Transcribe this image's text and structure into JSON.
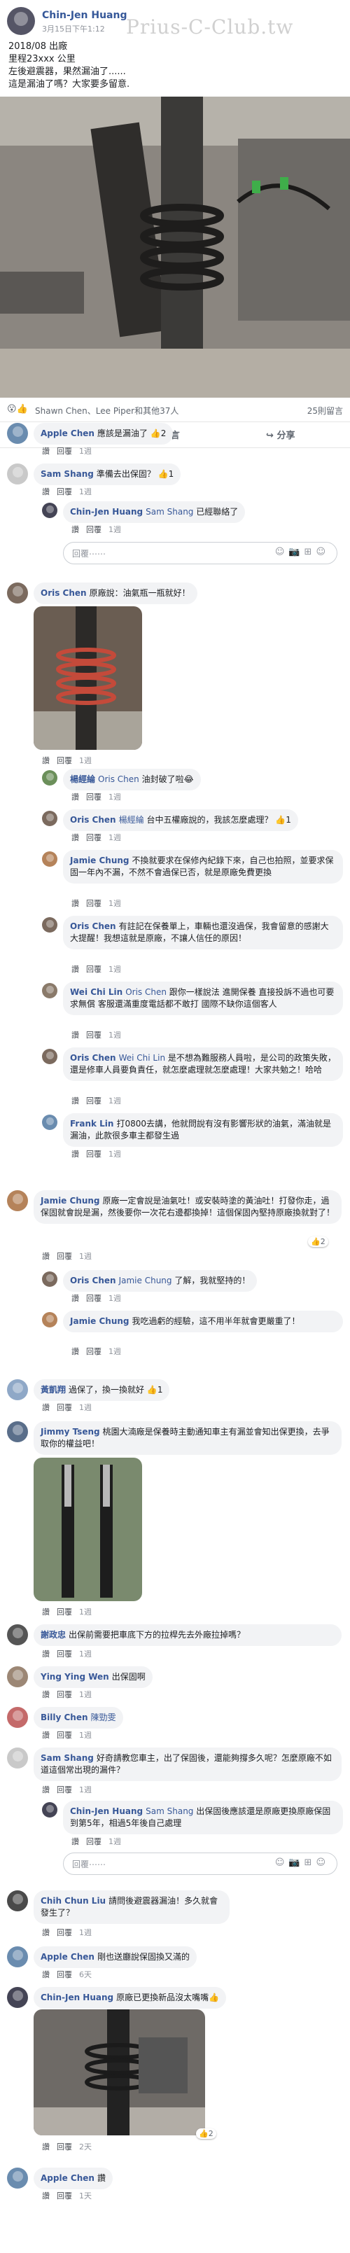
{
  "post": {
    "author": "Chin-Jen Huang",
    "date": "3月15日下午1:12",
    "watermark": "Prius-C-Club.tw",
    "text_lines": [
      "2018/08 出廠",
      "里程23xxx 公里",
      "左後避震器，果然漏油了......",
      "這是漏油了嗎？大家要多留意."
    ],
    "reactions_text": "Shawn Chen、Lee Piper和其他37人",
    "comments_count": "25則留言",
    "actions": {
      "like": "讚",
      "comment": "留言",
      "share": "分享"
    }
  },
  "comments": [
    {
      "name": "Apple Chen",
      "text": "應該是漏油了",
      "likes": "2",
      "meta": [
        "讚",
        "回覆",
        "1週"
      ]
    },
    {
      "name": "Sam Shang",
      "text": "準備去出保固？",
      "likes": "1",
      "meta": [
        "讚",
        "回覆",
        "1週"
      ]
    },
    {
      "name": "Chin-Jen Huang",
      "tag": "Sam Shang",
      "text": "已經聯絡了",
      "meta": [
        "讚",
        "回覆",
        "1週"
      ]
    },
    {
      "name": "Oris Chen",
      "text": "原廠說：油氣瓶一瓶就好！",
      "meta": [
        "讚",
        "回覆",
        "1週"
      ]
    },
    {
      "name": "楊經綸",
      "tag": "Oris Chen",
      "text": "油封破了啦😂",
      "meta": [
        "讚",
        "回覆",
        "1週"
      ]
    },
    {
      "name": "Oris Chen",
      "tag": "楊經綸",
      "text": "台中五權廠說的，我該怎麼處理？",
      "likes": "1",
      "meta": [
        "讚",
        "回覆",
        "1週"
      ]
    },
    {
      "name": "Jamie Chung",
      "text": "不換就要求在保修內紀錄下來，自己也拍照，並要求保固一年內不漏，不然不會過保已否，就是原廠免費更換",
      "meta": [
        "讚",
        "回覆",
        "1週"
      ]
    },
    {
      "name": "Oris Chen",
      "text": "有註記在保養單上，車輛也還沒過保，我會留意的感謝大大提醒！我想這就是原廠，不讓人信任的原因！",
      "meta": [
        "讚",
        "回覆",
        "1週"
      ]
    },
    {
      "name": "Wei Chi Lin",
      "tag": "Oris Chen",
      "text": "跟你一樣說法 進開保養 直接投訴不過也可要求無償 客服還滿重度電話都不敢打 國際不缺你這個客人",
      "meta": [
        "讚",
        "回覆",
        "1週"
      ]
    },
    {
      "name": "Oris Chen",
      "tag": "Wei Chi Lin",
      "text": "是不想為難服務人員啦，是公司的政策失敗，還是修車人員要負責任，就怎麼處理就怎麼處理！大家共勉之！哈哈",
      "meta": [
        "讚",
        "回覆",
        "1週"
      ]
    },
    {
      "name": "Frank Lin",
      "text": "打0800去講，他就問說有沒有影響形狀的油氣，滿油就是漏油，此款很多車主都發生過",
      "meta": [
        "讚",
        "回覆",
        "1週"
      ]
    },
    {
      "name": "Jamie Chung",
      "text": "原廠一定會說是油氣吐！或安裝時塗的黃油吐！打發你走，過保固就會說是漏，然後要你一次花右邊都換掉！這個保固內堅持原廠換就對了！",
      "likes": "2",
      "meta": [
        "讚",
        "回覆",
        "1週"
      ]
    },
    {
      "name": "Oris Chen",
      "tag": "Jamie Chung",
      "text": "了解，我就堅持的！",
      "meta": [
        "讚",
        "回覆",
        "1週"
      ]
    },
    {
      "name": "Jamie Chung",
      "text": "我吃過虧的經驗，這不用半年就會更嚴重了！",
      "meta": [
        "讚",
        "回覆",
        "1週"
      ]
    },
    {
      "name": "黃凱翔",
      "text": "過保了，換一換就好",
      "likes": "1",
      "meta": [
        "讚",
        "回覆",
        "1週"
      ]
    },
    {
      "name": "Jimmy Tseng",
      "text": "桃園大湳廠是保養時主動通知車主有漏並會知出保更換，去爭取你的權益吧！",
      "meta": [
        "讚",
        "回覆",
        "1週"
      ]
    },
    {
      "name": "謝政忠",
      "text": "出保前需要把車底下方的拉桿先去外廠拉掉嗎？",
      "meta": [
        "讚",
        "回覆",
        "1週"
      ]
    },
    {
      "name": "Ying Ying Wen",
      "text": "出保固啊",
      "meta": [
        "讚",
        "回覆",
        "1週"
      ]
    },
    {
      "name": "Billy Chen",
      "text": "陳勁雯",
      "meta": [
        "讚",
        "回覆",
        "1週"
      ]
    },
    {
      "name": "Sam Shang",
      "text": "好奇請教您車主，出了保固後，還能夠撐多久呢？怎麼原廠不如道這個常出現的漏件？",
      "meta": [
        "讚",
        "回覆",
        "1週"
      ]
    },
    {
      "name": "Chin-Jen Huang",
      "tag": "Sam Shang",
      "text": "出保固後應該還是原廠更換原廠保固到第5年，相過5年後自己處理",
      "meta": [
        "讚",
        "回覆",
        "1週"
      ]
    },
    {
      "name": "Chih Chun Liu",
      "text": "請問後避震器漏油！多久就會發生了？",
      "meta": [
        "讚",
        "回覆",
        "1週"
      ]
    },
    {
      "name": "Apple Chen",
      "text": "剛也送廳說保固換又滿的",
      "meta": [
        "讚",
        "回覆",
        "6天"
      ]
    },
    {
      "name": "Chin-Jen Huang",
      "text": "原廠已更換新品沒太嘴嘴👍",
      "likes": "2",
      "meta": [
        "讚",
        "回覆",
        "2天"
      ]
    },
    {
      "name": "Apple Chen",
      "text": "讚",
      "meta": [
        "讚",
        "回覆",
        "1天"
      ]
    }
  ],
  "reply_placeholder": "回覆⋯⋯",
  "colors": {
    "link": "#385898",
    "bubble": "#f2f3f5",
    "meta": "#90949c"
  }
}
